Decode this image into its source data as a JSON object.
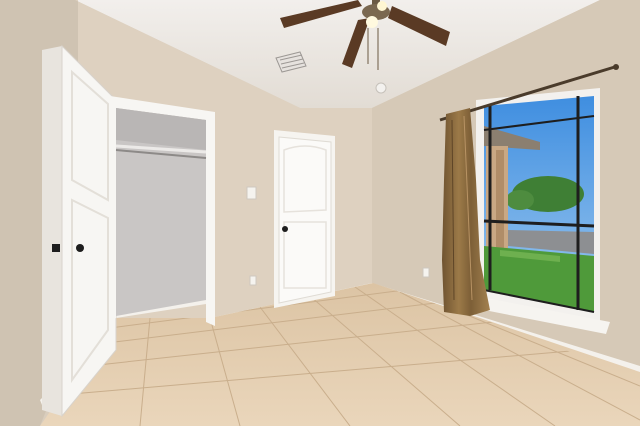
{
  "scene": {
    "description_icons": [
      "ceiling-fan-icon",
      "door-icon",
      "closet-icon",
      "window-icon",
      "curtain-icon",
      "light-switch-icon",
      "outlet-icon",
      "air-vent-icon"
    ],
    "colors": {
      "wall_left": "#d4c8b8",
      "wall_back": "#dfd3c3",
      "wall_right": "#d8ccbb",
      "ceiling": "#eeeae6",
      "floor": "#e3cdb0",
      "grout": "#cdb597",
      "trim": "#f6f4f0",
      "door": "#f7f6f3",
      "closet_interior": "#c9c7c6",
      "curtain": "#8a6a3e",
      "curtain_rod": "#4a3b2b",
      "sky": "#5a9fe0",
      "grass": "#4f9a3a",
      "fan_blade": "#5a3a24"
    }
  }
}
